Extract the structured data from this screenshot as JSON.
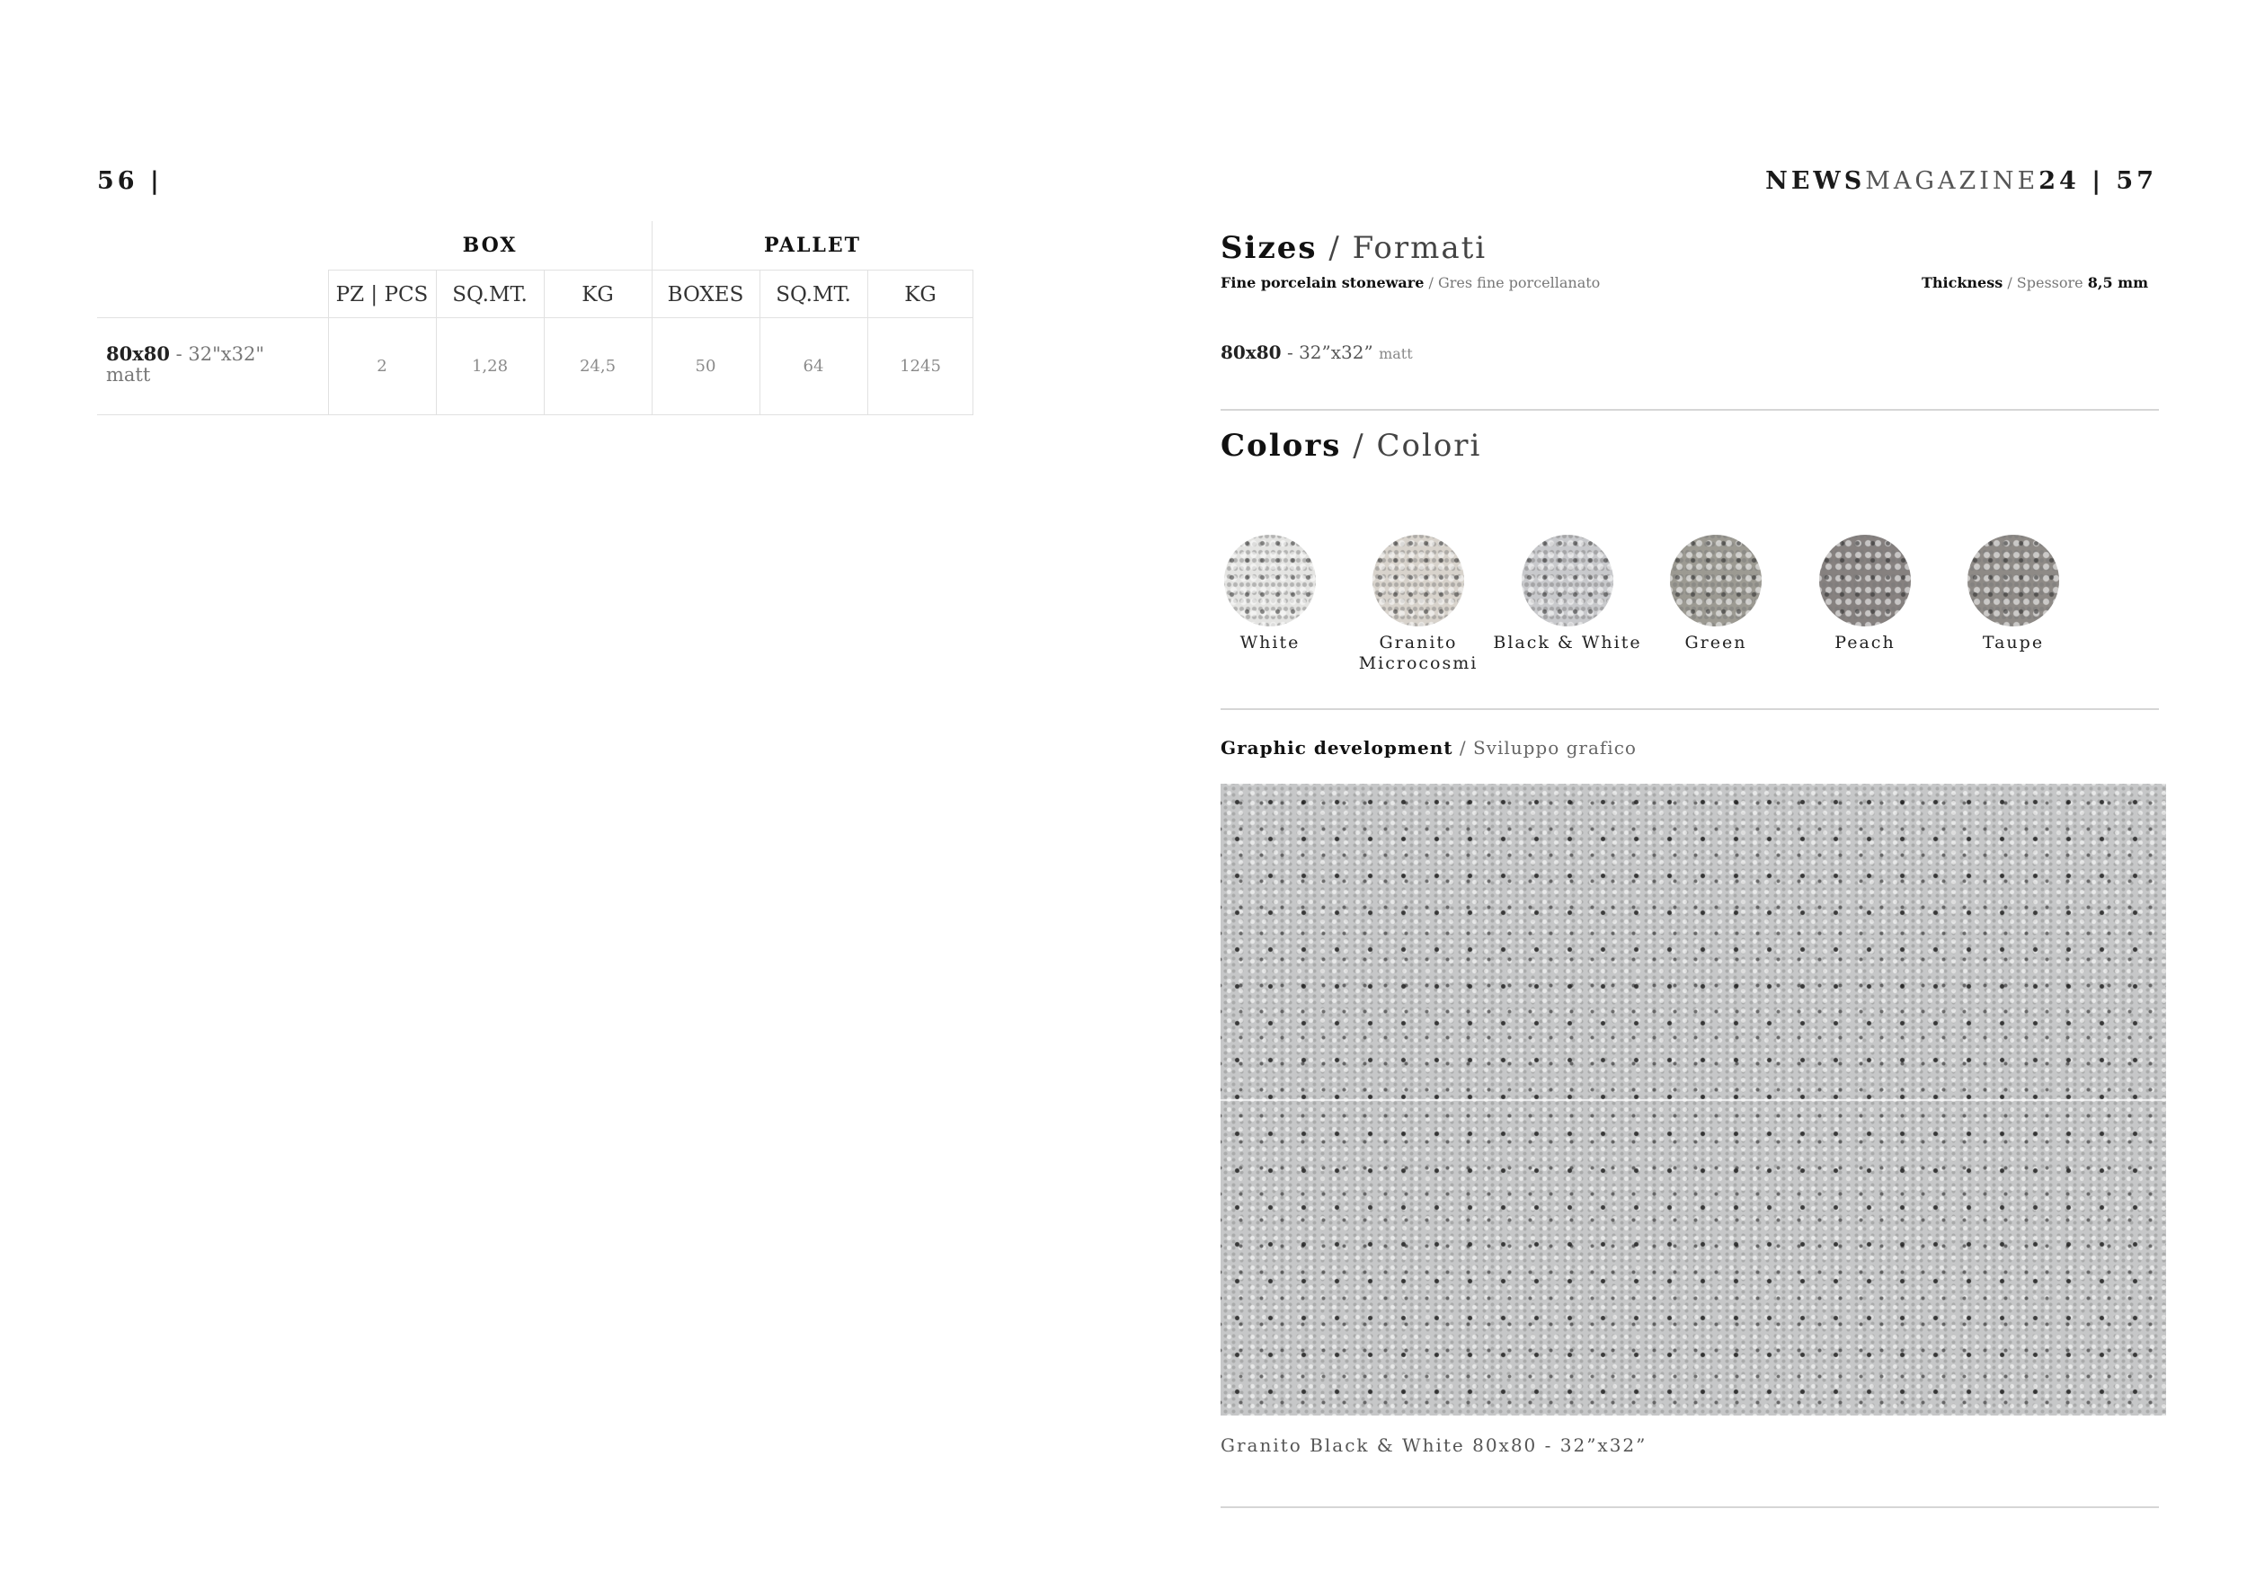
{
  "header": {
    "left_page_number": "56 |",
    "right_brand_bold": "NEWS",
    "right_brand_light": "MAGAZINE",
    "right_brand_number": "24 | 57"
  },
  "table": {
    "groups": [
      "BOX",
      "PALLET"
    ],
    "columns": [
      "PZ | PCS",
      "SQ.MT.",
      "KG",
      "BOXES",
      "SQ.MT.",
      "KG"
    ],
    "rows": [
      {
        "format": "80x80",
        "format_inch": " - 32\"x32\"",
        "finish": "matt",
        "values": [
          "2",
          "1,28",
          "24,5",
          "50",
          "64",
          "1245"
        ]
      }
    ]
  },
  "sizes": {
    "title_bold": "Sizes",
    "title_light": " / Formati",
    "material_bold": "Fine porcelain stoneware",
    "material_light": " / Gres fine porcellanato",
    "thickness_bold": "Thickness",
    "thickness_light": " / Spessore ",
    "thickness_value": "8,5 mm",
    "item_format": "80x80",
    "item_inch": " - 32”x32” ",
    "item_finish": "matt"
  },
  "colors": {
    "title_bold": "Colors",
    "title_light": " / Colori",
    "items": [
      {
        "label": "White",
        "color": "#e4e4e2"
      },
      {
        "label": "Granito Microcosmi",
        "color": "#d8d3cc"
      },
      {
        "label": "Black & White",
        "color": "#c8c9cc"
      },
      {
        "label": "Green",
        "color": "#9c9a92"
      },
      {
        "label": "Peach",
        "color": "#86817f"
      },
      {
        "label": "Taupe",
        "color": "#8e8a86"
      }
    ]
  },
  "graphic": {
    "title_bold": "Graphic development",
    "title_light": " / Sviluppo grafico",
    "caption": "Granito Black & White 80x80 - 32”x32”"
  }
}
